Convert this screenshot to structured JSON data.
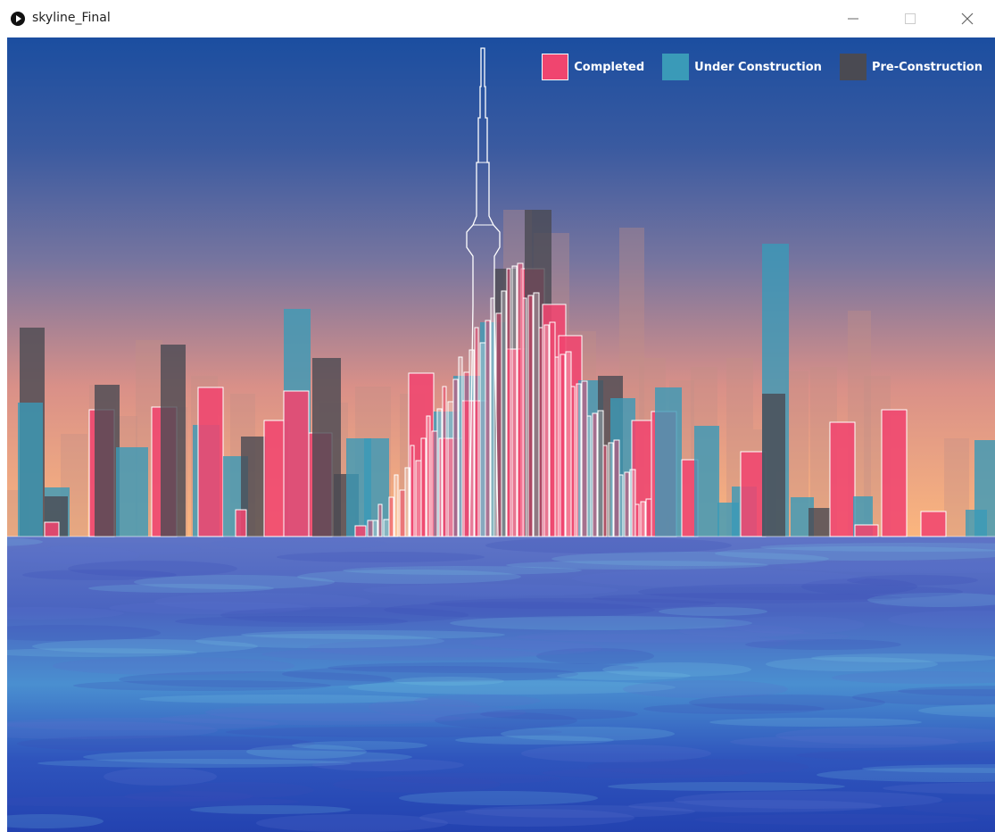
{
  "window": {
    "title": "skyline_Final",
    "minimize_icon": "minimize-icon",
    "maximize_icon": "maximize-icon",
    "close_icon": "close-icon",
    "app_icon": "processing-play-icon"
  },
  "legend": {
    "items": [
      {
        "label": "Completed",
        "color": "#f0456f"
      },
      {
        "label": "Under Construction",
        "color": "#3a9ab8"
      },
      {
        "label": "Pre-Construction",
        "color": "#4a4a52"
      }
    ]
  },
  "colors": {
    "sky_top": "#1b4ea0",
    "sky_mid": "#6d73a6",
    "sky_horizon": "#fbb67e",
    "water_deep": "#2546b8",
    "water_light": "#4aa5d6",
    "outline": "#ffffff"
  }
}
